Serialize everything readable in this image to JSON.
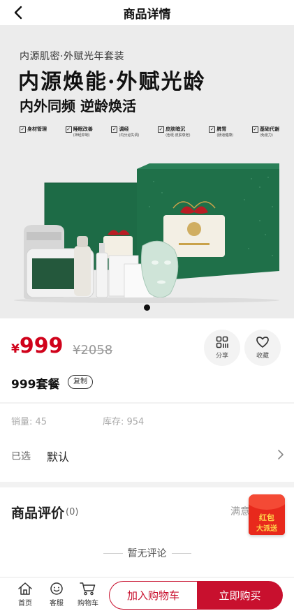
{
  "header": {
    "title": "商品详情"
  },
  "banner": {
    "subtitle": "内源肌密·外赋光年套装",
    "title": "内源焕能·外赋光龄",
    "slogan": "内外同频 逆龄焕活",
    "features": [
      {
        "main": "身材管理",
        "sub": ""
      },
      {
        "main": "睡眠改善",
        "sub": "(神经抑制)"
      },
      {
        "main": "调经",
        "sub": "(内分泌失调)"
      },
      {
        "main": "皮肤暗沉",
        "sub": "(色斑·皮肤衰老)"
      },
      {
        "main": "脾胃",
        "sub": "(肠道健康)"
      },
      {
        "main": "基础代谢",
        "sub": "(免疫力)"
      }
    ],
    "colors": {
      "box_green": "#1c6a45",
      "ribbon_red": "#b81d24",
      "gold": "#c9a24a"
    }
  },
  "price": {
    "currency": "¥",
    "current": "999",
    "original": "¥2058",
    "color": "#d0021b"
  },
  "actions": {
    "share_label": "分享",
    "favorite_label": "收藏"
  },
  "product": {
    "name": "999套餐",
    "copy_label": "复制"
  },
  "stats": {
    "sales": "销量: 45",
    "stock": "库存: 954"
  },
  "selection": {
    "label": "已选",
    "value": "默认"
  },
  "reviews": {
    "title": "商品评价",
    "count": "(0)",
    "satisfaction": "满意",
    "empty_text": "暂无评论"
  },
  "hongbao": {
    "line1": "红包",
    "line2": "大派送"
  },
  "bottom_nav": {
    "home": "首页",
    "service": "客服",
    "cart": "购物车",
    "add_to_cart": "加入购物车",
    "buy_now": "立即购买"
  }
}
